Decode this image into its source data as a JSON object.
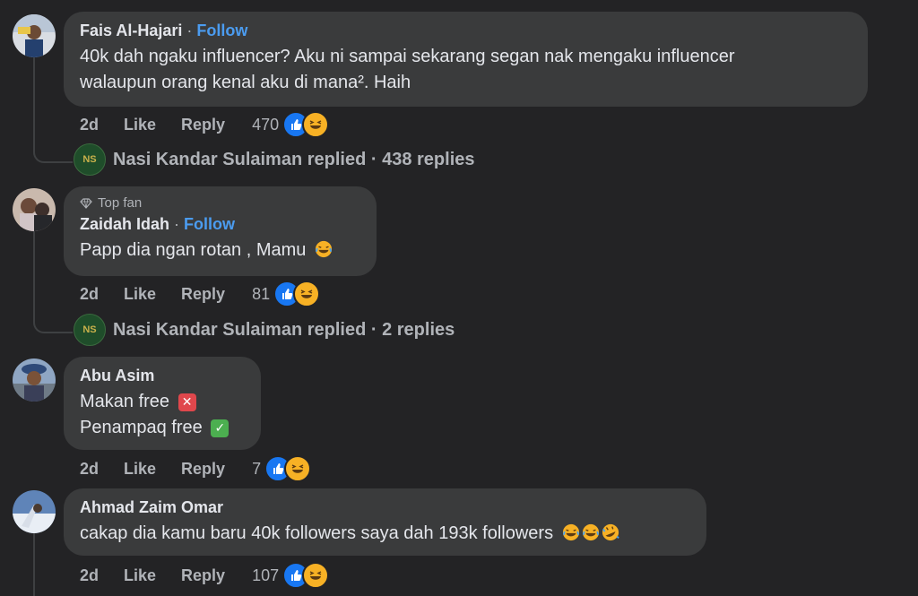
{
  "comments": [
    {
      "author": "Fais Al-Hajari",
      "follow": "Follow",
      "text_line1": "40k dah ngaku influencer? Aku ni sampai sekarang segan nak mengaku influencer",
      "text_line2": "walaupun orang kenal aku di mana². Haih",
      "time": "2d",
      "like": "Like",
      "reply": "Reply",
      "reactions": "470",
      "replied_by": "Nasi Kandar Sulaiman replied · 438 replies"
    },
    {
      "badge": "Top fan",
      "author": "Zaidah Idah",
      "follow": "Follow",
      "text": "Papp dia ngan rotan , Mamu",
      "time": "2d",
      "like": "Like",
      "reply": "Reply",
      "reactions": "81",
      "replied_by": "Nasi Kandar Sulaiman replied · 2 replies"
    },
    {
      "author": "Abu Asim",
      "text_line1": "Makan free",
      "text_line2": "Penampaq free",
      "time": "2d",
      "like": "Like",
      "reply": "Reply",
      "reactions": "7"
    },
    {
      "author": "Ahmad Zaim Omar",
      "text": "cakap dia kamu baru 40k followers saya dah 193k followers",
      "time": "2d",
      "like": "Like",
      "reply": "Reply",
      "reactions": "107"
    }
  ],
  "colors": {
    "background": "#232325",
    "bubble": "#3a3b3c",
    "follow": "#4b9cf0",
    "like_blue": "#1877f2",
    "haha_yellow": "#f7b125"
  }
}
